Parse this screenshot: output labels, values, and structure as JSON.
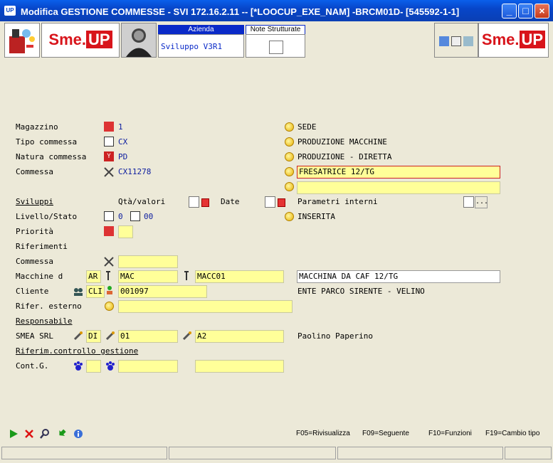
{
  "window": {
    "title": "Modifica   GESTIONE COMMESSE - SVI 172.16.2.11 -- [*LOOCUP_EXE_NAM] -BRCM01D- [545592-1-1]",
    "app_icon": "UP"
  },
  "toolbar": {
    "logo_left": "Sme.",
    "logo_left_up": "UP",
    "logo_right": "Sme.",
    "logo_right_up": "UP",
    "azienda_header": "Azienda",
    "azienda_value": "Sviluppo V3R1",
    "note_header": "Note Strutturate"
  },
  "form": {
    "magazzino": {
      "label": "Magazzino",
      "value": "1",
      "desc": "SEDE"
    },
    "tipo": {
      "label": "Tipo commessa",
      "value": "CX",
      "desc": "PRODUZIONE MACCHINE"
    },
    "natura": {
      "label": "Natura commessa",
      "value": "PD",
      "desc": "PRODUZIONE - DIRETTA"
    },
    "commessa": {
      "label": "Commessa",
      "value": "CX11278",
      "desc1": "FRESATRICE 12/TG",
      "desc2": ""
    },
    "sviluppi": {
      "label": "Sviluppi",
      "qta_label": "Qtà/valori",
      "date_label": "Date",
      "param_label": "Parametri interni",
      "param_btn": "..."
    },
    "livello": {
      "label": "Livello/Stato",
      "livello_value": "0",
      "stato_value": "00",
      "desc": "INSERITA"
    },
    "priorita": {
      "label": "Priorità",
      "value": ""
    },
    "riferimenti": {
      "label": "Riferimenti"
    },
    "rif_commessa": {
      "label": "Commessa",
      "value": ""
    },
    "macchine": {
      "label": "Macchine d",
      "code": "AR",
      "v1": "MAC",
      "v2": "MACC01",
      "desc": "MACCHINA DA CAF 12/TG"
    },
    "cliente": {
      "label": "Cliente",
      "code": "CLI",
      "value": "001097",
      "desc": "ENTE PARCO SIRENTE - VELINO"
    },
    "rifer_esterno": {
      "label": "Rifer. esterno",
      "value": ""
    },
    "responsabile": {
      "label": "Responsabile"
    },
    "smea": {
      "label": "SMEA SRL",
      "code": "DI",
      "v1": "01",
      "v2": "A2",
      "desc": "Paolino Paperino"
    },
    "riferim_controllo": {
      "label": "Riferim.controllo gestione"
    },
    "cont": {
      "label": "Cont.G.",
      "v1": "",
      "v2": "",
      "v3": ""
    }
  },
  "fkeys": {
    "f05": "F05=Rivisualizza",
    "f09": "F09=Seguente",
    "f10": "F10=Funzioni",
    "f19": "F19=Cambio tipo"
  }
}
